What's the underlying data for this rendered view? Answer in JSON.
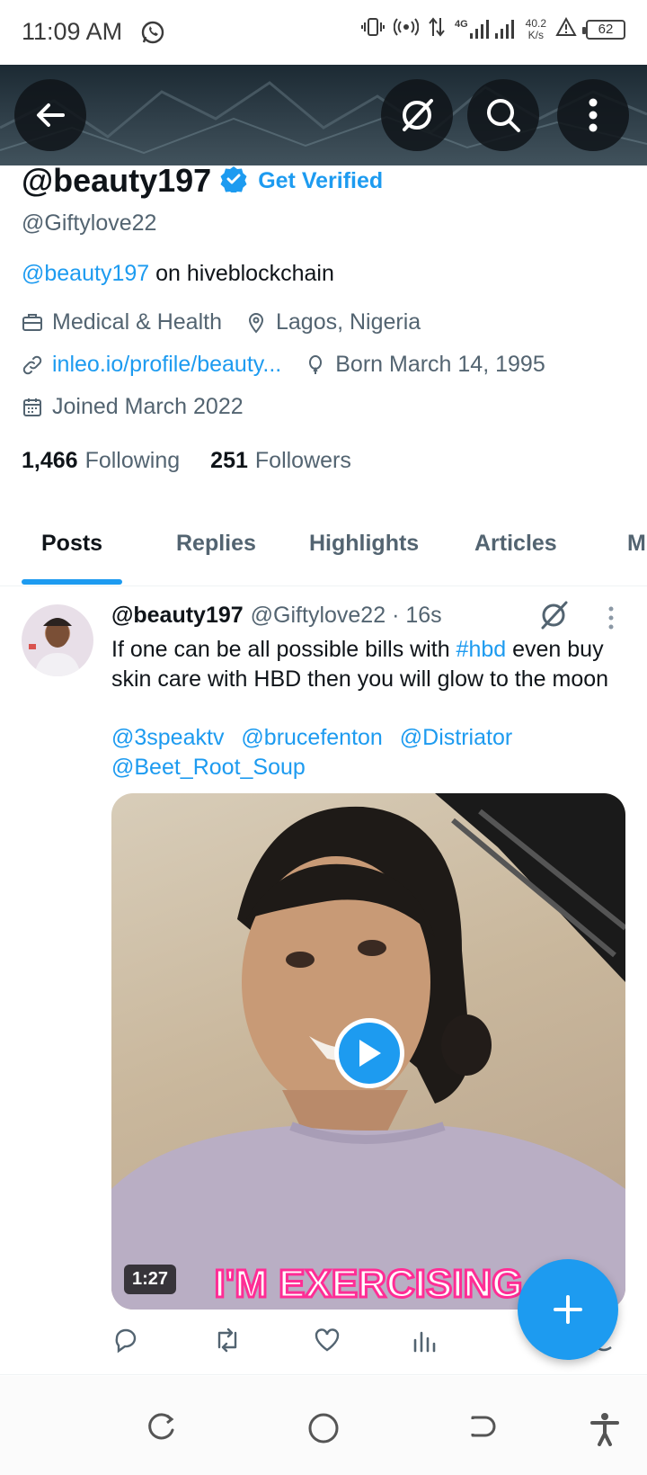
{
  "status_bar": {
    "time": "11:09 AM",
    "network_type": "4G",
    "speed_value": "40.2",
    "speed_unit": "K/s",
    "battery": "62"
  },
  "profile": {
    "display_name": "@beauty197",
    "get_verified": "Get Verified",
    "handle": "@Giftylove22",
    "bio_mention": "@beauty197",
    "bio_text": " on hiveblockchain",
    "category": "Medical & Health",
    "location": "Lagos, Nigeria",
    "website": "inleo.io/profile/beauty...",
    "birthday": "Born March 14, 1995",
    "joined": "Joined March 2022",
    "following_count": "1,466",
    "following_label": "Following",
    "followers_count": "251",
    "followers_label": "Followers"
  },
  "tabs": [
    {
      "label": "Posts",
      "active": true
    },
    {
      "label": "Replies"
    },
    {
      "label": "Highlights"
    },
    {
      "label": "Articles"
    },
    {
      "label": "M"
    }
  ],
  "post": {
    "author_name": "@beauty197",
    "author_handle": "@Giftylove22",
    "time": "· 16s",
    "text_before": "If one can be all possible bills with ",
    "hashtag": "#hbd",
    "text_after": " even buy skin care with HBD then you will glow to the moon",
    "mentions": [
      "@3speaktv",
      "@brucefenton",
      "@Distriator",
      "@Beet_Root_Soup"
    ],
    "video_duration": "1:27",
    "video_caption": "I'M EXERCISING"
  },
  "colors": {
    "accent": "#1d9bf0",
    "text_primary": "#0f1419",
    "text_secondary": "#536471"
  },
  "icons": {
    "back": "arrow-left-icon",
    "grok": "grok-icon",
    "search": "search-icon",
    "more": "more-vertical-icon",
    "verified": "verified-badge-icon",
    "fab": "plus-icon"
  }
}
